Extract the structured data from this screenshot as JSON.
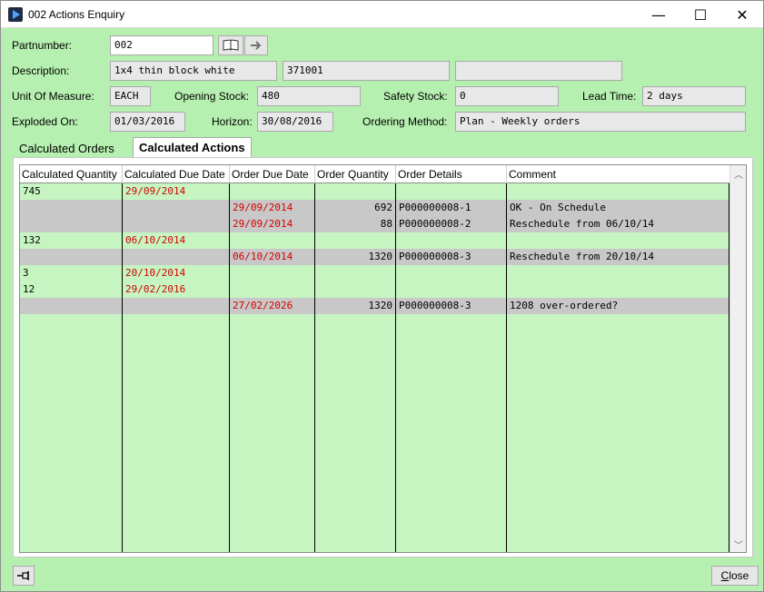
{
  "window": {
    "title": "002 Actions Enquiry",
    "minimize": "—",
    "maximize": "☐",
    "close": "✕"
  },
  "form": {
    "partnumber_label": "Partnumber:",
    "partnumber_value": "002",
    "description_label": "Description:",
    "description_value": "1x4 thin block white",
    "description_code": "371001",
    "description_extra": "",
    "uom_label": "Unit Of Measure:",
    "uom_value": "EACH",
    "opening_stock_label": "Opening Stock:",
    "opening_stock_value": "480",
    "safety_stock_label": "Safety Stock:",
    "safety_stock_value": "0",
    "lead_time_label": "Lead Time:",
    "lead_time_value": "2 days",
    "exploded_on_label": "Exploded On:",
    "exploded_on_value": "01/03/2016",
    "horizon_label": "Horizon:",
    "horizon_value": "30/08/2016",
    "ordering_method_label": "Ordering Method:",
    "ordering_method_value": "Plan - Weekly orders"
  },
  "tabs": {
    "calculated_orders": "Calculated Orders",
    "calculated_actions": "Calculated Actions"
  },
  "grid": {
    "headers": {
      "calc_qty": "Calculated Quantity",
      "calc_due": "Calculated Due Date",
      "order_due": "Order Due Date",
      "order_qty": "Order Quantity",
      "order_details": "Order Details",
      "comment": "Comment"
    },
    "rows": [
      {
        "calc_qty": "745",
        "calc_due": "29/09/2014",
        "order_due": "",
        "order_qty": "",
        "order_details": "",
        "comment": ""
      },
      {
        "calc_qty": "",
        "calc_due": "",
        "order_due": "29/09/2014",
        "order_qty": "692",
        "order_details": "P000000008-1",
        "comment": "OK - On Schedule"
      },
      {
        "calc_qty": "",
        "calc_due": "",
        "order_due": "29/09/2014",
        "order_qty": "88",
        "order_details": "P000000008-2",
        "comment": "Reschedule from 06/10/14"
      },
      {
        "calc_qty": "132",
        "calc_due": "06/10/2014",
        "order_due": "",
        "order_qty": "",
        "order_details": "",
        "comment": ""
      },
      {
        "calc_qty": "",
        "calc_due": "",
        "order_due": "06/10/2014",
        "order_qty": "1320",
        "order_details": "P000000008-3",
        "comment": "Reschedule from 20/10/14"
      },
      {
        "calc_qty": "3",
        "calc_due": "20/10/2014",
        "order_due": "",
        "order_qty": "",
        "order_details": "",
        "comment": ""
      },
      {
        "calc_qty": "12",
        "calc_due": "29/02/2016",
        "order_due": "",
        "order_qty": "",
        "order_details": "",
        "comment": ""
      },
      {
        "calc_qty": "",
        "calc_due": "",
        "order_due": "27/02/2026",
        "order_qty": "1320",
        "order_details": "P000000008-3",
        "comment": "1208 over-ordered?"
      }
    ]
  },
  "footer": {
    "pin_icon": "pin-icon",
    "close_prefix": "",
    "close_mnemonic": "C",
    "close_rest": "lose"
  },
  "colors": {
    "window_bg": "#b6f0b0",
    "grid_bg": "#c6f5c2",
    "order_row_bg": "#c8c8c8",
    "date_red": "#d40000"
  }
}
